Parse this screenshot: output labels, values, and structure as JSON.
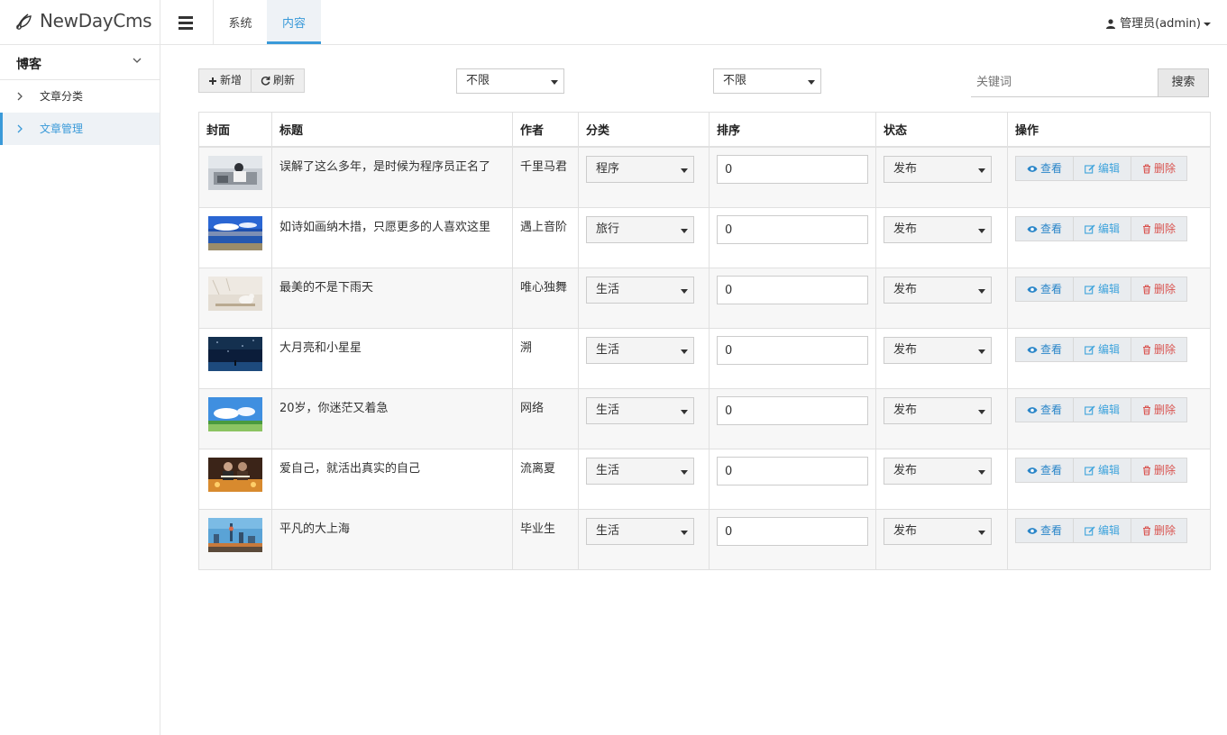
{
  "app": {
    "brand": "NewDayCms",
    "tabs": [
      {
        "label": "系统",
        "active": false
      },
      {
        "label": "内容",
        "active": true
      }
    ],
    "user": "管理员(admin)"
  },
  "sidebar": {
    "group": "博客",
    "items": [
      {
        "label": "文章分类",
        "active": false
      },
      {
        "label": "文章管理",
        "active": true
      }
    ]
  },
  "toolbar": {
    "add_label": "新增",
    "refresh_label": "刷新",
    "filter1": "不限",
    "filter2": "不限",
    "search_placeholder": "关键词",
    "search_label": "搜索"
  },
  "table": {
    "columns": [
      "封面",
      "标题",
      "作者",
      "分类",
      "排序",
      "状态",
      "操作"
    ],
    "actions": {
      "view": "查看",
      "edit": "编辑",
      "delete": "删除"
    },
    "rows": [
      {
        "title": "误解了这么多年，是时候为程序员正名了",
        "author": "千里马君",
        "category": "程序",
        "sort": "0",
        "status": "发布",
        "cover": "office-photo"
      },
      {
        "title": "如诗如画纳木措，只愿更多的人喜欢这里",
        "author": "遇上音阶",
        "category": "旅行",
        "sort": "0",
        "status": "发布",
        "cover": "lake-photo"
      },
      {
        "title": "最美的不是下雨天",
        "author": "唯心独舞",
        "category": "生活",
        "sort": "0",
        "status": "发布",
        "cover": "bird-photo"
      },
      {
        "title": "大月亮和小星星",
        "author": "溯",
        "category": "生活",
        "sort": "0",
        "status": "发布",
        "cover": "night-sky-photo"
      },
      {
        "title": "20岁，你迷茫又着急",
        "author": "网络",
        "category": "生活",
        "sort": "0",
        "status": "发布",
        "cover": "sky-meadow-photo"
      },
      {
        "title": "爱自己，就活出真实的自己",
        "author": "流离夏",
        "category": "生活",
        "sort": "0",
        "status": "发布",
        "cover": "concert-photo"
      },
      {
        "title": "平凡的大上海",
        "author": "毕业生",
        "category": "生活",
        "sort": "0",
        "status": "发布",
        "cover": "city-photo"
      }
    ]
  },
  "colors": {
    "accent": "#3a9ad9",
    "danger": "#d9534f",
    "row_stripe": "#f7f7f7"
  }
}
